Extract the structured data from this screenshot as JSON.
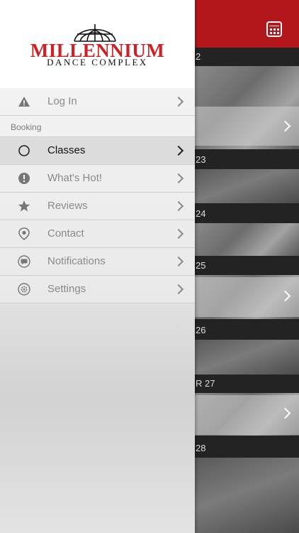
{
  "brand": {
    "title": "MILLENNIUM",
    "subtitle": "DANCE COMPLEX",
    "title_color": "#d11f24"
  },
  "menu": {
    "login": {
      "label": "Log In",
      "icon": "warning-icon"
    },
    "section_label": "Booking",
    "items": [
      {
        "label": "Classes",
        "icon": "circle-icon",
        "active": true
      },
      {
        "label": "What's Hot!",
        "icon": "exclamation-icon",
        "active": false
      },
      {
        "label": "Reviews",
        "icon": "star-icon",
        "active": false
      },
      {
        "label": "Contact",
        "icon": "location-pin-icon",
        "active": false
      },
      {
        "label": "Notifications",
        "icon": "chat-bubble-icon",
        "active": false
      },
      {
        "label": "Settings",
        "icon": "gear-icon",
        "active": false
      }
    ]
  },
  "background": {
    "header_color": "#b3171b",
    "calendar_icon": "calendar-icon",
    "day_headers": [
      "2",
      "23",
      "24",
      "25",
      "26",
      "R 27",
      "28"
    ]
  }
}
